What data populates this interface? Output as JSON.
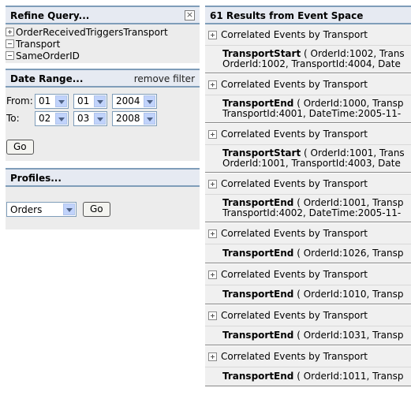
{
  "refine": {
    "title": "Refine Query...",
    "close_glyph": "×",
    "items": [
      "OrderReceivedTriggersTransport",
      "Transport",
      "SameOrderID"
    ]
  },
  "date_range": {
    "title": "Date Range...",
    "remove_label": "remove filter",
    "from_label": "From:",
    "to_label": "To:",
    "from": {
      "month": "01",
      "day": "01",
      "year": "2004"
    },
    "to": {
      "month": "02",
      "day": "03",
      "year": "2008"
    },
    "go_label": "Go"
  },
  "profiles": {
    "title": "Profiles...",
    "selected": "Orders",
    "go_label": "Go"
  },
  "results": {
    "header": "61 Results from Event Space",
    "events": [
      {
        "title": "Correlated Events by Transport",
        "event": "TransportStart",
        "line1": " ( OrderId:1002, Trans",
        "line2": "OrderId:1002, TransportId:4004, Date"
      },
      {
        "title": "Correlated Events by Transport",
        "event": "TransportEnd",
        "line1": " ( OrderId:1000, Transp",
        "line2": "TransportId:4001, DateTime:2005-11-"
      },
      {
        "title": "Correlated Events by Transport",
        "event": "TransportStart",
        "line1": " ( OrderId:1001, Trans",
        "line2": "OrderId:1001, TransportId:4003, Date"
      },
      {
        "title": "Correlated Events by Transport",
        "event": "TransportEnd",
        "line1": " ( OrderId:1001, Transp",
        "line2": "TransportId:4002, DateTime:2005-11-"
      },
      {
        "title": "Correlated Events by Transport",
        "event": "TransportEnd",
        "line1": " ( OrderId:1026, Transp",
        "line2": ""
      },
      {
        "title": "Correlated Events by Transport",
        "event": "TransportEnd",
        "line1": " ( OrderId:1010, Transp",
        "line2": ""
      },
      {
        "title": "Correlated Events by Transport",
        "event": "TransportEnd",
        "line1": " ( OrderId:1031, Transp",
        "line2": ""
      },
      {
        "title": "Correlated Events by Transport",
        "event": "TransportEnd",
        "line1": " ( OrderId:1011, Transp",
        "line2": ""
      }
    ]
  }
}
